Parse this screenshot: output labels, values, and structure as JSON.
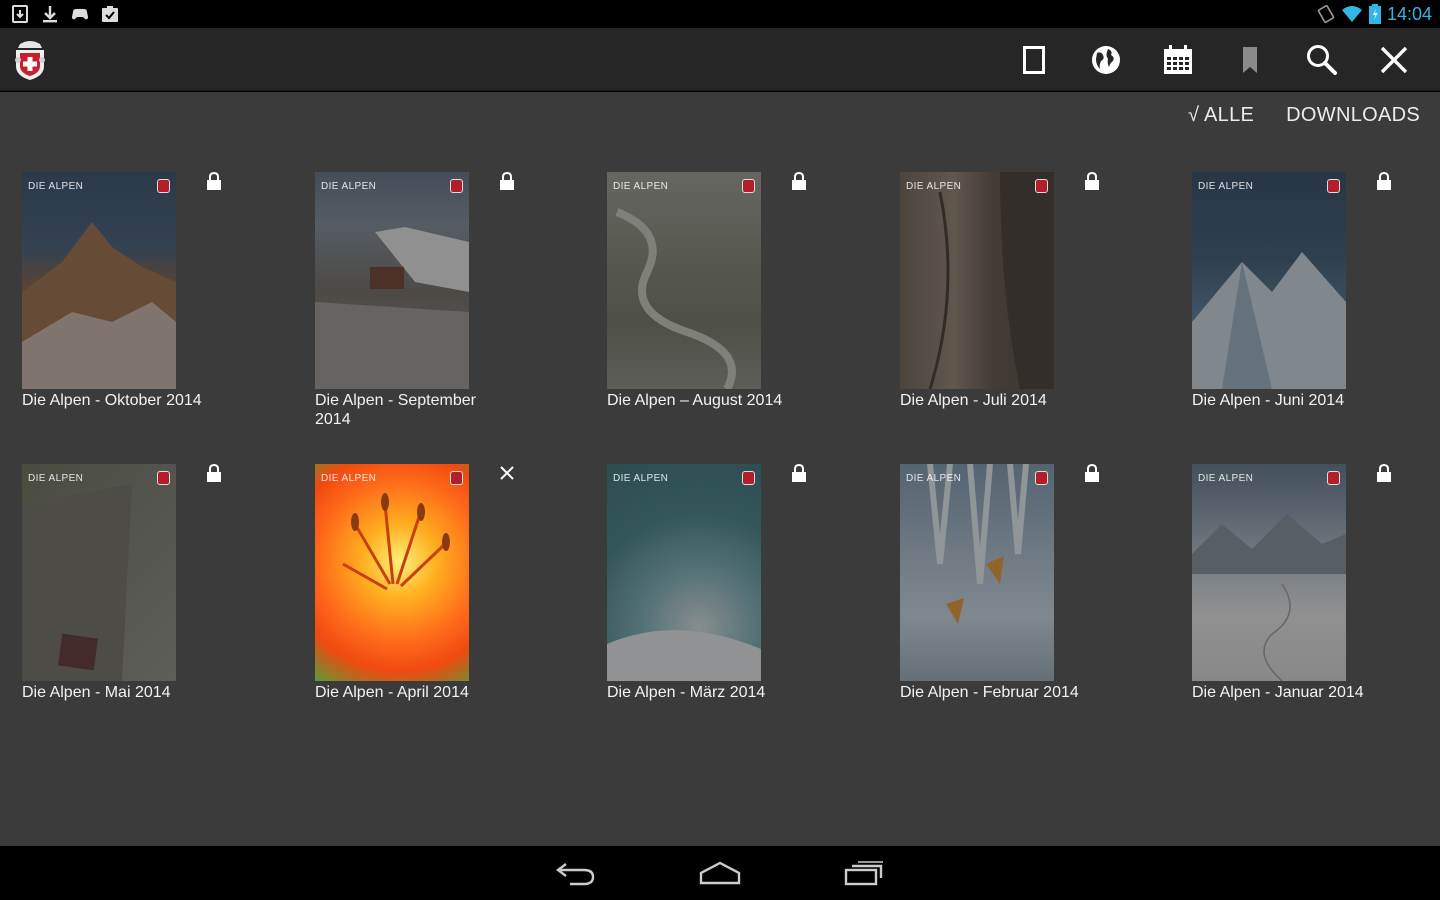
{
  "status_bar": {
    "time": "14:04",
    "left_icons": [
      "sd-card-icon",
      "download-icon",
      "gamepad-icon",
      "clipboard-check-icon"
    ],
    "right_icons": [
      "rotate-icon",
      "wifi-icon",
      "battery-icon"
    ],
    "time_color": "#33b5e5"
  },
  "action_bar": {
    "logo_icon": "sac-logo-icon",
    "actions": [
      "single-page-icon",
      "globe-icon",
      "calendar-icon",
      "bookmark-icon",
      "search-icon",
      "close-icon"
    ]
  },
  "filters": {
    "all_label": "√ ALLE",
    "downloads_label": "DOWNLOADS"
  },
  "issues": [
    {
      "title": "Die Alpen - Oktober 2014",
      "cover_text": "DIE ALPEN",
      "status_icon": "lock-icon",
      "cover_colors": [
        "#2d4a66",
        "#8a5a3a",
        "#c9925a"
      ]
    },
    {
      "title": "Die Alpen - September 2014",
      "cover_text": "DIE ALPEN",
      "status_icon": "lock-icon",
      "cover_colors": [
        "#6b7c8a",
        "#7a7068",
        "#d8d8d8"
      ]
    },
    {
      "title": "Die Alpen – August 2014",
      "cover_text": "DIE ALPEN",
      "status_icon": "lock-icon",
      "cover_colors": [
        "#9a9a92",
        "#6e7262",
        "#b8b8b0"
      ]
    },
    {
      "title": "Die Alpen - Juli 2014",
      "cover_text": "DIE ALPEN",
      "status_icon": "lock-icon",
      "cover_colors": [
        "#6a5e52",
        "#8e7e6c",
        "#4a3e34"
      ]
    },
    {
      "title": "Die Alpen - Juni 2014",
      "cover_text": "DIE ALPEN",
      "status_icon": "lock-icon",
      "cover_colors": [
        "#27435e",
        "#5a7d9a",
        "#c8d6e0"
      ]
    },
    {
      "title": "Die Alpen - Mai 2014",
      "cover_text": "DIE ALPEN",
      "status_icon": "lock-icon",
      "cover_colors": [
        "#646a50",
        "#7a7a70",
        "#5e2c30"
      ]
    },
    {
      "title": "Die Alpen - April 2014",
      "cover_text": "DIE ALPEN",
      "status_icon": "delete-icon",
      "cover_colors": [
        "#ff6a1a",
        "#f7931e",
        "#5a9a3a"
      ]
    },
    {
      "title": "Die Alpen - März 2014",
      "cover_text": "DIE ALPEN",
      "status_icon": "lock-icon",
      "cover_colors": [
        "#2f6a72",
        "#5aa0a8",
        "#d8e0e2"
      ]
    },
    {
      "title": "Die Alpen - Februar 2014",
      "cover_text": "DIE ALPEN",
      "status_icon": "lock-icon",
      "cover_colors": [
        "#7896ae",
        "#c8d8e4",
        "#e8962e"
      ]
    },
    {
      "title": "Die Alpen - Januar 2014",
      "cover_text": "DIE ALPEN",
      "status_icon": "lock-icon",
      "cover_colors": [
        "#5a7084",
        "#b8c4cc",
        "#e6e6e6"
      ]
    }
  ],
  "nav_bar": {
    "buttons": [
      "back-icon",
      "home-icon",
      "recent-apps-icon"
    ]
  }
}
